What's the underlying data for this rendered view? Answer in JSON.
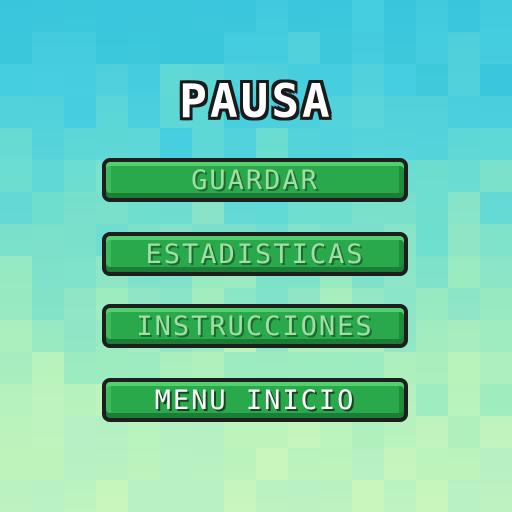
{
  "screen": {
    "title": "PAUSA"
  },
  "menu": {
    "items": [
      {
        "label": "GUARDAR",
        "selected": false
      },
      {
        "label": "ESTADISTICAS",
        "selected": false
      },
      {
        "label": "INSTRUCCIONES",
        "selected": false
      },
      {
        "label": "MENU INICIO",
        "selected": true
      }
    ]
  },
  "colors": {
    "button_green": "#2aa84c",
    "button_border": "#1e1e1e",
    "label_dim": "#9fdfa4",
    "label_selected": "#ffffff",
    "background_top": "#3ac6dc",
    "background_bottom": "#c9f6bc"
  }
}
